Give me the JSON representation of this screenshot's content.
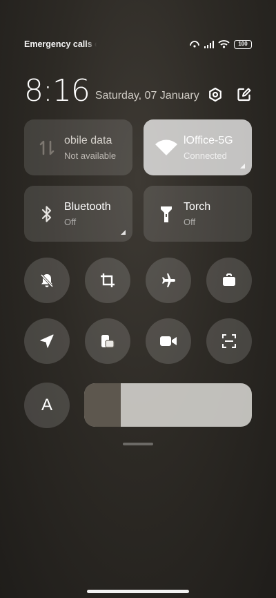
{
  "status": {
    "carrier_text": "Emergency calls o",
    "battery": "100"
  },
  "header": {
    "time": "8:16",
    "date": "Saturday, 07 January",
    "icons": [
      "settings-icon",
      "edit-icon"
    ]
  },
  "tiles": [
    {
      "title": "obile data",
      "subtitle": "Not available",
      "icon": "mobile-data-icon",
      "active": false
    },
    {
      "title": "lOffice-5G",
      "subtitle": "Connected",
      "icon": "wifi-icon",
      "active": true
    },
    {
      "title": "Bluetooth",
      "subtitle": "Off",
      "icon": "bluetooth-icon",
      "active": false
    },
    {
      "title": "Torch",
      "subtitle": "Off",
      "icon": "torch-icon",
      "active": false
    }
  ],
  "toggles_row1": [
    "mute-icon",
    "crop-screenshot-icon",
    "airplane-icon",
    "work-profile-icon"
  ],
  "toggles_row2": [
    "location-icon",
    "floating-window-icon",
    "screen-record-icon",
    "scanner-icon"
  ],
  "font_button": {
    "label": "A"
  },
  "brightness": {
    "level": 0.22
  }
}
